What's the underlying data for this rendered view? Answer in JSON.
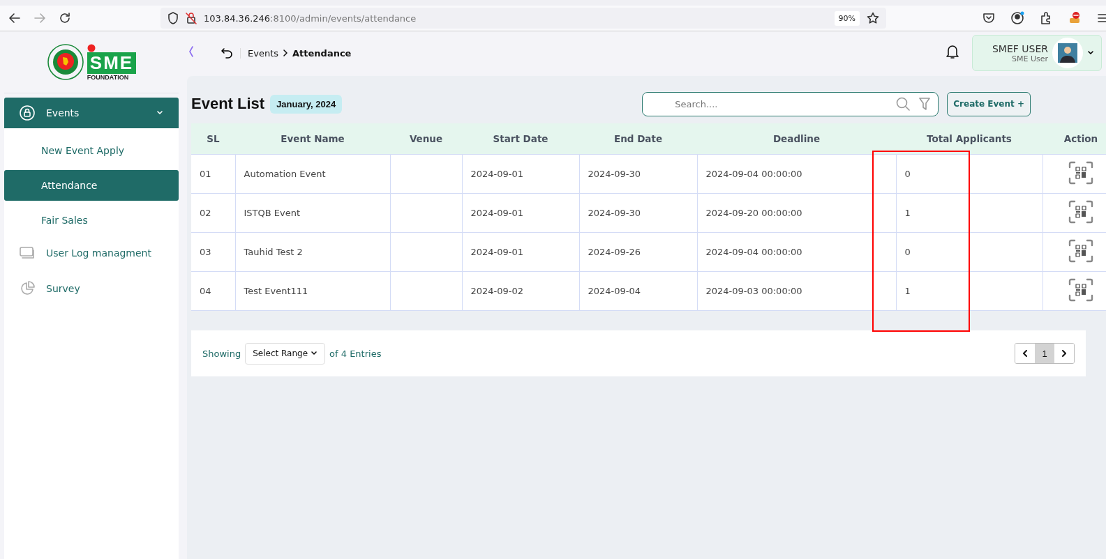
{
  "browser": {
    "url_host": "103.84.36.246",
    "url_rest": ":8100/admin/events/attendance",
    "zoom": "90%"
  },
  "header": {
    "breadcrumb": [
      {
        "label": "Events",
        "current": false
      },
      {
        "label": "Attendance",
        "current": true
      }
    ],
    "user": {
      "name": "SMEF USER",
      "role": "SME User"
    }
  },
  "logo": {
    "text": "SME",
    "subtext": "FOUNDATION"
  },
  "sidebar": {
    "items": [
      {
        "label": "Events",
        "kind": "lock",
        "expanded": true,
        "children": [
          {
            "label": "New Event Apply",
            "selected": false
          },
          {
            "label": "Attendance",
            "selected": true
          },
          {
            "label": "Fair Sales",
            "selected": false
          }
        ]
      },
      {
        "label": "User Log managment",
        "kind": "log",
        "expanded": false
      },
      {
        "label": "Survey",
        "kind": "pie",
        "expanded": false
      }
    ]
  },
  "page": {
    "title": "Event List",
    "badge": "January, 2024",
    "search": {
      "placeholder": "Search...."
    },
    "create_button": "Create Event +"
  },
  "table": {
    "columns": [
      "SL",
      "Event Name",
      "Venue",
      "Start Date",
      "End Date",
      "Deadline",
      "Total Applicants",
      "Action"
    ],
    "rows": [
      [
        "01",
        "Automation Event",
        "",
        "2024-09-01",
        "2024-09-30",
        "2024-09-04 00:00:00",
        "0"
      ],
      [
        "02",
        "ISTQB Event",
        "",
        "2024-09-01",
        "2024-09-30",
        "2024-09-20 00:00:00",
        "1"
      ],
      [
        "03",
        "Tauhid Test 2",
        "",
        "2024-09-01",
        "2024-09-26",
        "2024-09-04 00:00:00",
        "0"
      ],
      [
        "04",
        "Test Event111",
        "",
        "2024-09-02",
        "2024-09-04",
        "2024-09-03 00:00:00",
        "1"
      ]
    ]
  },
  "footer": {
    "showing": "Showing",
    "range": "Select Range",
    "entries": "of 4 Entries",
    "pages": [
      {
        "label": "1",
        "selected": true
      }
    ]
  }
}
